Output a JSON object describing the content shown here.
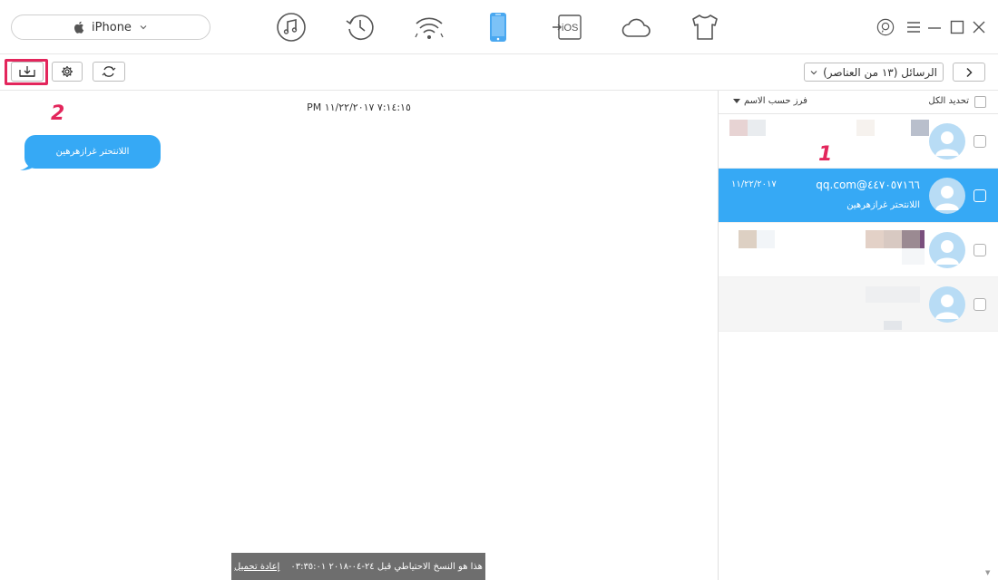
{
  "device": {
    "name": "iPhone"
  },
  "nav": [
    {
      "name": "music-icon"
    },
    {
      "name": "history-icon"
    },
    {
      "name": "wifi-icon"
    },
    {
      "name": "iphone-icon"
    },
    {
      "name": "ios-transfer-icon",
      "label": "iOS"
    },
    {
      "name": "cloud-icon"
    },
    {
      "name": "tshirt-icon"
    }
  ],
  "toolbar": {
    "folder_label": "الرسائل (١٣ من العناصر)"
  },
  "list": {
    "select_all": "تحديد الكل",
    "sort_label": "فرز حسب الاسم",
    "selected_item": {
      "contact": "qq.com@٤٤٧٠٥٧١٦٦",
      "date": "١١/٢٢/٢٠١٧",
      "preview": "اللانتحتر غرازهرهين"
    }
  },
  "conversation": {
    "timestamp": "PM ٧:١٤:١٥ ١١/٢٢/٢٠١٧",
    "message": "اللانتحتر غرازهرهين"
  },
  "notice": {
    "text": "هذا هو النسخ الاحتياطي قبل ٢٤-٠٤-٢٠١٨ ٠٣:٣٥:٠١",
    "reload": "إعادة تحميل"
  },
  "annotations": {
    "one": "1",
    "two": "2"
  },
  "colors": {
    "accent": "#36a9f5",
    "highlight": "#e3265c"
  }
}
